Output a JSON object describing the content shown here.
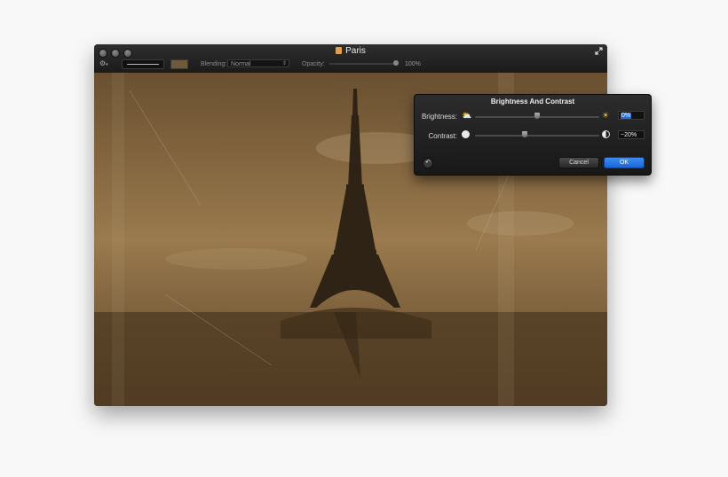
{
  "window": {
    "title": "Paris",
    "icons": {
      "document": "document-icon",
      "fullscreen": "fullscreen-icon",
      "tools": "gear-icon"
    }
  },
  "toolbar": {
    "blending_label": "Blending:",
    "blending_value": "Normal",
    "opacity_label": "Opacity:",
    "opacity_value": "100%",
    "opacity_level": 1.0,
    "swatch_color": "#6e5a3a"
  },
  "photo": {
    "subject": "Eiffel Tower sepia photograph",
    "sepia_color": "#8a6a40"
  },
  "dialog": {
    "title": "Brightness And Contrast",
    "brightness_label": "Brightness:",
    "brightness_value": "0%",
    "brightness_level": 0.5,
    "contrast_label": "Contrast:",
    "contrast_value": "−20%",
    "contrast_level": 0.4,
    "cancel_label": "Cancel",
    "ok_label": "OK",
    "accent_color": "#2a6edb"
  }
}
